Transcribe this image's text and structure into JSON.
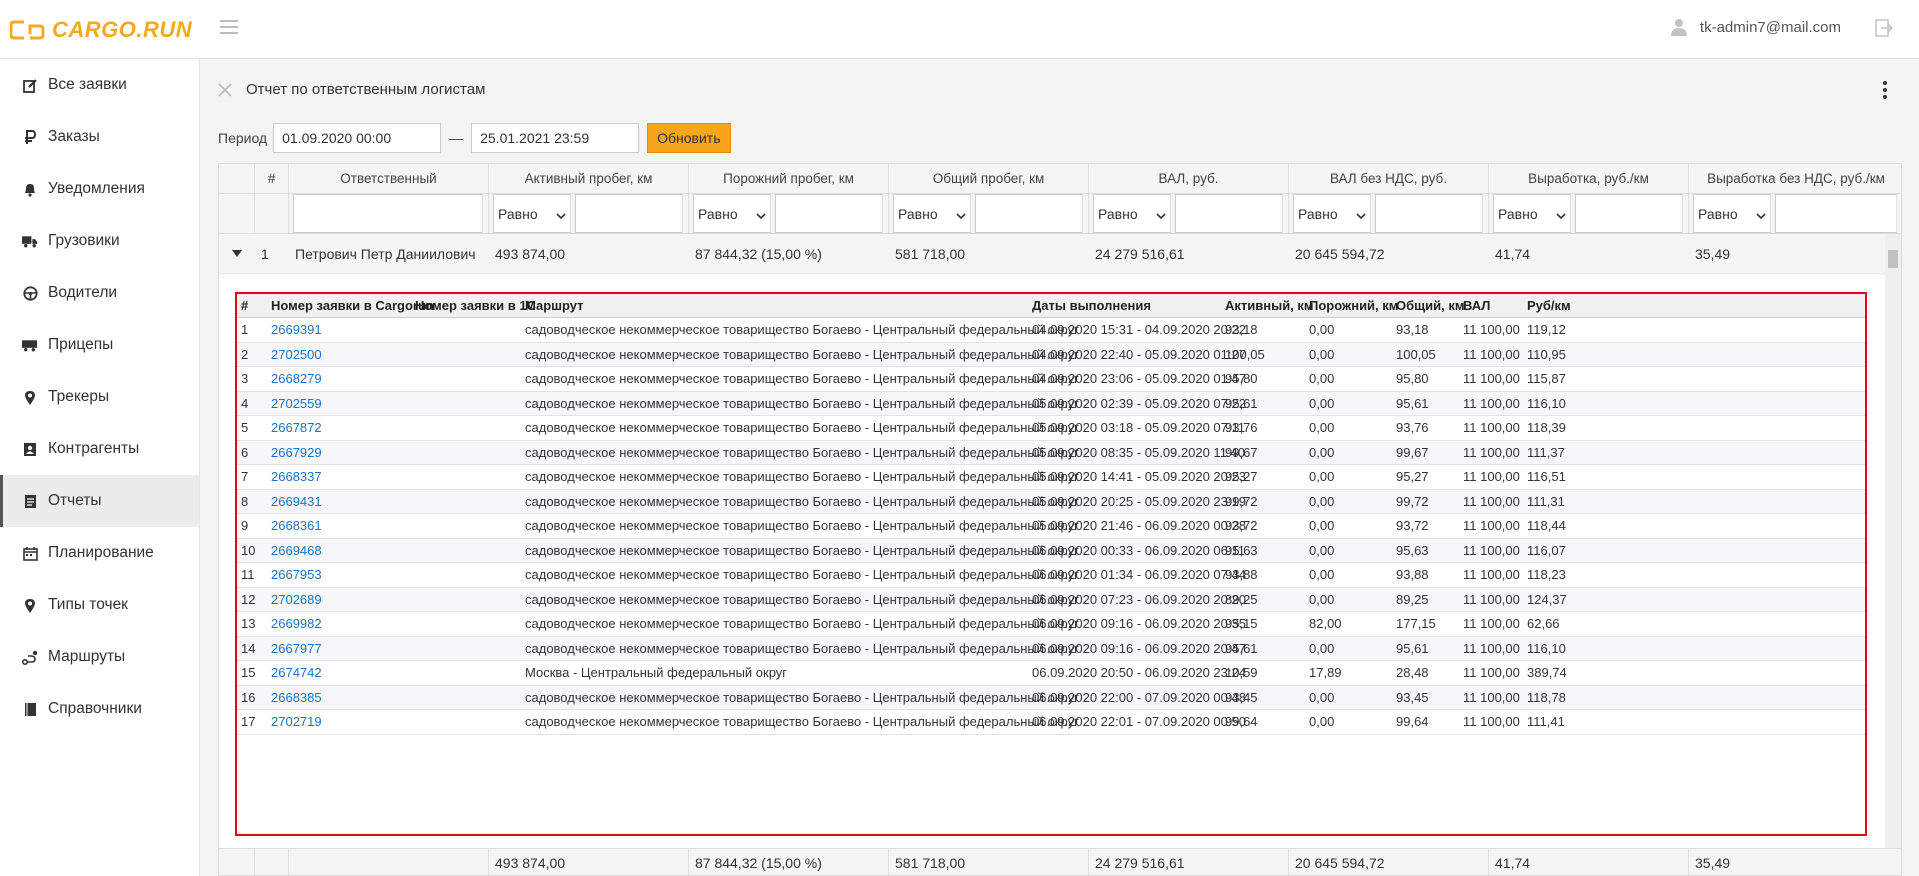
{
  "app": {
    "logo_text": "CARGO.RUN"
  },
  "user": {
    "email": "tk-admin7@mail.com"
  },
  "sidebar": {
    "items": [
      {
        "label": "Все заявки",
        "icon": "edit-icon"
      },
      {
        "label": "Заказы",
        "icon": "ruble-icon"
      },
      {
        "label": "Уведомления",
        "icon": "bell-icon"
      },
      {
        "label": "Грузовики",
        "icon": "truck-icon"
      },
      {
        "label": "Водители",
        "icon": "steering-wheel-icon"
      },
      {
        "label": "Прицепы",
        "icon": "trailer-icon"
      },
      {
        "label": "Трекеры",
        "icon": "map-marker-icon"
      },
      {
        "label": "Контрагенты",
        "icon": "contacts-icon"
      },
      {
        "label": "Отчеты",
        "icon": "report-icon"
      },
      {
        "label": "Планирование",
        "icon": "calendar-icon"
      },
      {
        "label": "Типы точек",
        "icon": "map-marker-icon"
      },
      {
        "label": "Маршруты",
        "icon": "route-icon"
      },
      {
        "label": "Справочники",
        "icon": "book-icon"
      }
    ],
    "active_index": 8
  },
  "report": {
    "title": "Отчет по ответственным логистам",
    "period_label": "Период",
    "period_from": "01.09.2020 00:00",
    "period_dash": "—",
    "period_to": "25.01.2021 23:59",
    "refresh_label": "Обновить"
  },
  "grid": {
    "columns": [
      "#",
      "Ответственный",
      "Активный пробег, км",
      "Порожний пробег, км",
      "Общий пробег, км",
      "ВАЛ, руб.",
      "ВАЛ без НДС, руб.",
      "Выработка, руб./км",
      "Выработка без НДС, руб./км"
    ],
    "filter_op": "Равно",
    "row": {
      "num": "1",
      "responsible": "Петрович Петр Даниилович",
      "active": "493 874,00",
      "empty": "87 844,32 (15,00 %)",
      "total": "581 718,00",
      "val": "24 279 516,61",
      "val_no_vat": "20 645 594,72",
      "output": "41,74",
      "output_no_vat": "35,49"
    },
    "footer": {
      "active": "493 874,00",
      "empty": "87 844,32 (15,00 %)",
      "total": "581 718,00",
      "val": "24 279 516,61",
      "val_no_vat": "20 645 594,72",
      "output": "41,74",
      "output_no_vat": "35,49"
    }
  },
  "detail": {
    "columns": [
      "#",
      "Номер заявки в Cargorun",
      "Номер заявки в 1С",
      "Маршрут",
      "Даты выполнения",
      "Активный, км",
      "Порожний, км",
      "Общий, км",
      "ВАЛ",
      "Руб/км"
    ],
    "rows": [
      [
        "1",
        "2669391",
        "",
        "садоводческое некоммерческое товарищество Богаево - Центральный федеральный округ",
        "04.09.2020 15:31 - 04.09.2020 20:22",
        "93,18",
        "0,00",
        "93,18",
        "11 100,00",
        "119,12"
      ],
      [
        "2",
        "2702500",
        "",
        "садоводческое некоммерческое товарищество Богаево - Центральный федеральный округ",
        "04.09.2020 22:40 - 05.09.2020 01:27",
        "100,05",
        "0,00",
        "100,05",
        "11 100,00",
        "110,95"
      ],
      [
        "3",
        "2668279",
        "",
        "садоводческое некоммерческое товарищество Богаево - Центральный федеральный округ",
        "04.09.2020 23:06 - 05.09.2020 01:47",
        "95,80",
        "0,00",
        "95,80",
        "11 100,00",
        "115,87"
      ],
      [
        "4",
        "2702559",
        "",
        "садоводческое некоммерческое товарищество Богаево - Центральный федеральный округ",
        "05.09.2020 02:39 - 05.09.2020 07:22",
        "95,61",
        "0,00",
        "95,61",
        "11 100,00",
        "116,10"
      ],
      [
        "5",
        "2667872",
        "",
        "садоводческое некоммерческое товарищество Богаево - Центральный федеральный округ",
        "05.09.2020 03:18 - 05.09.2020 07:11",
        "93,76",
        "0,00",
        "93,76",
        "11 100,00",
        "118,39"
      ],
      [
        "6",
        "2667929",
        "",
        "садоводческое некоммерческое товарищество Богаево - Центральный федеральный округ",
        "05.09.2020 08:35 - 05.09.2020 11:40",
        "99,67",
        "0,00",
        "99,67",
        "11 100,00",
        "111,37"
      ],
      [
        "7",
        "2668337",
        "",
        "садоводческое некоммерческое товарищество Богаево - Центральный федеральный округ",
        "05.09.2020 14:41 - 05.09.2020 20:23",
        "95,27",
        "0,00",
        "95,27",
        "11 100,00",
        "116,51"
      ],
      [
        "8",
        "2669431",
        "",
        "садоводческое некоммерческое товарищество Богаево - Центральный федеральный округ",
        "05.09.2020 20:25 - 05.09.2020 23:19",
        "99,72",
        "0,00",
        "99,72",
        "11 100,00",
        "111,31"
      ],
      [
        "9",
        "2668361",
        "",
        "садоводческое некоммерческое товарищество Богаево - Центральный федеральный округ",
        "05.09.2020 21:46 - 06.09.2020 00:28",
        "93,72",
        "0,00",
        "93,72",
        "11 100,00",
        "118,44"
      ],
      [
        "10",
        "2669468",
        "",
        "садоводческое некоммерческое товарищество Богаево - Центральный федеральный округ",
        "06.09.2020 00:33 - 06.09.2020 06:11",
        "95,63",
        "0,00",
        "95,63",
        "11 100,00",
        "116,07"
      ],
      [
        "11",
        "2667953",
        "",
        "садоводческое некоммерческое товарищество Богаево - Центральный федеральный округ",
        "06.09.2020 01:34 - 06.09.2020 07:44",
        "93,88",
        "0,00",
        "93,88",
        "11 100,00",
        "118,23"
      ],
      [
        "12",
        "2702689",
        "",
        "садоводческое некоммерческое товарищество Богаево - Центральный федеральный округ",
        "06.09.2020 07:23 - 06.09.2020 20:20",
        "89,25",
        "0,00",
        "89,25",
        "11 100,00",
        "124,37"
      ],
      [
        "13",
        "2669982",
        "",
        "садоводческое некоммерческое товарищество Богаево - Центральный федеральный округ",
        "06.09.2020 09:16 - 06.09.2020 20:35",
        "95,15",
        "82,00",
        "177,15",
        "11 100,00",
        "62,66"
      ],
      [
        "14",
        "2667977",
        "",
        "садоводческое некоммерческое товарищество Богаево - Центральный федеральный округ",
        "06.09.2020 09:16 - 06.09.2020 20:47",
        "95,61",
        "0,00",
        "95,61",
        "11 100,00",
        "116,10"
      ],
      [
        "15",
        "2674742",
        "",
        "Москва - Центральный федеральный округ",
        "06.09.2020 20:50 - 06.09.2020 23:24",
        "10,59",
        "17,89",
        "28,48",
        "11 100,00",
        "389,74"
      ],
      [
        "16",
        "2668385",
        "",
        "садоводческое некоммерческое товарищество Богаево - Центральный федеральный округ",
        "06.09.2020 22:00 - 07.09.2020 00:48",
        "93,45",
        "0,00",
        "93,45",
        "11 100,00",
        "118,78"
      ],
      [
        "17",
        "2702719",
        "",
        "садоводческое некоммерческое товарищество Богаево - Центральный федеральный округ",
        "06.09.2020 22:01 - 07.09.2020 00:50",
        "99,64",
        "0,00",
        "99,64",
        "11 100,00",
        "111,41"
      ]
    ]
  }
}
